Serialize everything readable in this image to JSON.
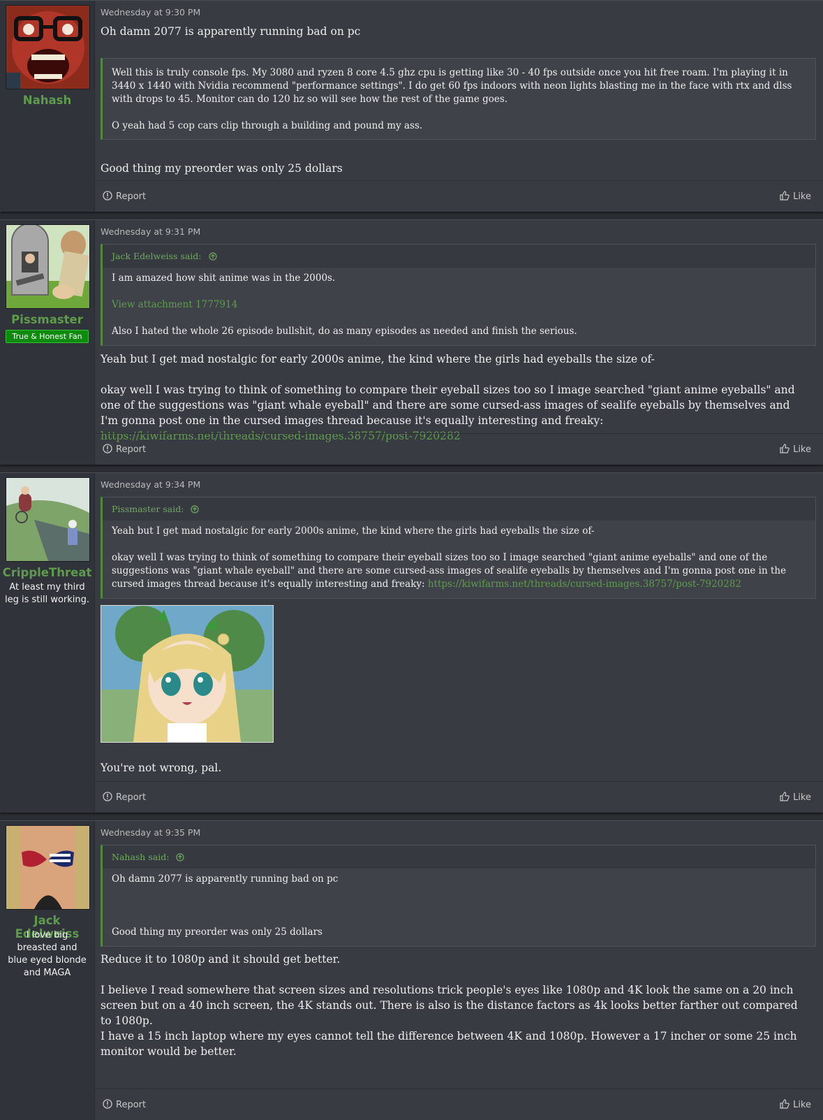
{
  "footer_labels": {
    "report": "Report",
    "like": "Like"
  },
  "posts": [
    {
      "username": "Nahash",
      "date": "Wednesday at 9:30 PM",
      "body_top": "Oh damn 2077 is apparently running bad on pc",
      "quote": {
        "p1": "Well this is truly console fps. My 3080 and ryzen 8 core 4.5 ghz cpu is getting like 30 - 40 fps outside once you hit free roam. I'm playing it in 3440 x 1440 with Nvidia recommend \"performance settings\". I do get 60 fps indoors with neon lights blasting me in the face with rtx and dlss with drops to 45. Monitor can do 120 hz so will see how the rest of the game goes.",
        "p2": "O yeah had 5 cop cars clip through a building and pound my ass."
      },
      "body_bottom": "Good thing my preorder was only 25 dollars"
    },
    {
      "username": "Pissmaster",
      "badge": "True & Honest Fan",
      "date": "Wednesday at 9:31 PM",
      "quote": {
        "author": "Jack Edelweiss said:",
        "p1": "I am amazed how shit anime was in the 2000s.",
        "attachment": "View attachment 1777914",
        "p2": "Also I hated the whole 26 episode bullshit, do as many episodes as needed and finish the serious."
      },
      "p1": "Yeah but I get mad nostalgic for early 2000s anime, the kind where the girls had eyeballs the size of-",
      "p2": "okay well I was trying to think of something to compare their eyeball sizes too so I image searched \"giant anime eyeballs\" and one of the suggestions was \"giant whale eyeball\" and there are some cursed-ass images of sealife eyeballs by themselves and I'm gonna post one in the cursed images thread because it's equally interesting and freaky: ",
      "link": "https://kiwifarms.net/threads/cursed-images.38757/post-7920282"
    },
    {
      "username": "CrippleThreat",
      "user_title": "At least my third leg is still working.",
      "date": "Wednesday at 9:34 PM",
      "quote": {
        "author": "Pissmaster said:",
        "p1": "Yeah but I get mad nostalgic for early 2000s anime, the kind where the girls had eyeballs the size of-",
        "p2": "okay well I was trying to think of something to compare their eyeball sizes too so I image searched \"giant anime eyeballs\" and one of the suggestions was \"giant whale eyeball\" and there are some cursed-ass images of sealife eyeballs by themselves and I'm gonna post one in the cursed images thread because it's equally interesting and freaky: ",
        "link": "https://kiwifarms.net/threads/cursed-images.38757/post-7920282"
      },
      "body": "You're not wrong, pal."
    },
    {
      "username": "Jack Edelweiss",
      "user_title": "I love big breasted and blue eyed blonde and MAGA",
      "date": "Wednesday at 9:35 PM",
      "quote": {
        "author": "Nahash said:",
        "p1": "Oh damn 2077 is apparently running bad on pc",
        "p2": "Good thing my preorder was only 25 dollars"
      },
      "p1": "Reduce it to 1080p and it should get better.",
      "p2": "I believe I read somewhere that screen sizes and resolutions trick people's eyes like 1080p and 4K look the same on a 20 inch screen but on a 40 inch screen, the 4K stands out. There is also is the distance factors as 4k looks better farther out compared to 1080p.",
      "p3": "I have a 15 inch laptop where my eyes cannot tell the difference between 4K and 1080p. However a 17 incher or some 25 inch monitor would be better."
    }
  ]
}
